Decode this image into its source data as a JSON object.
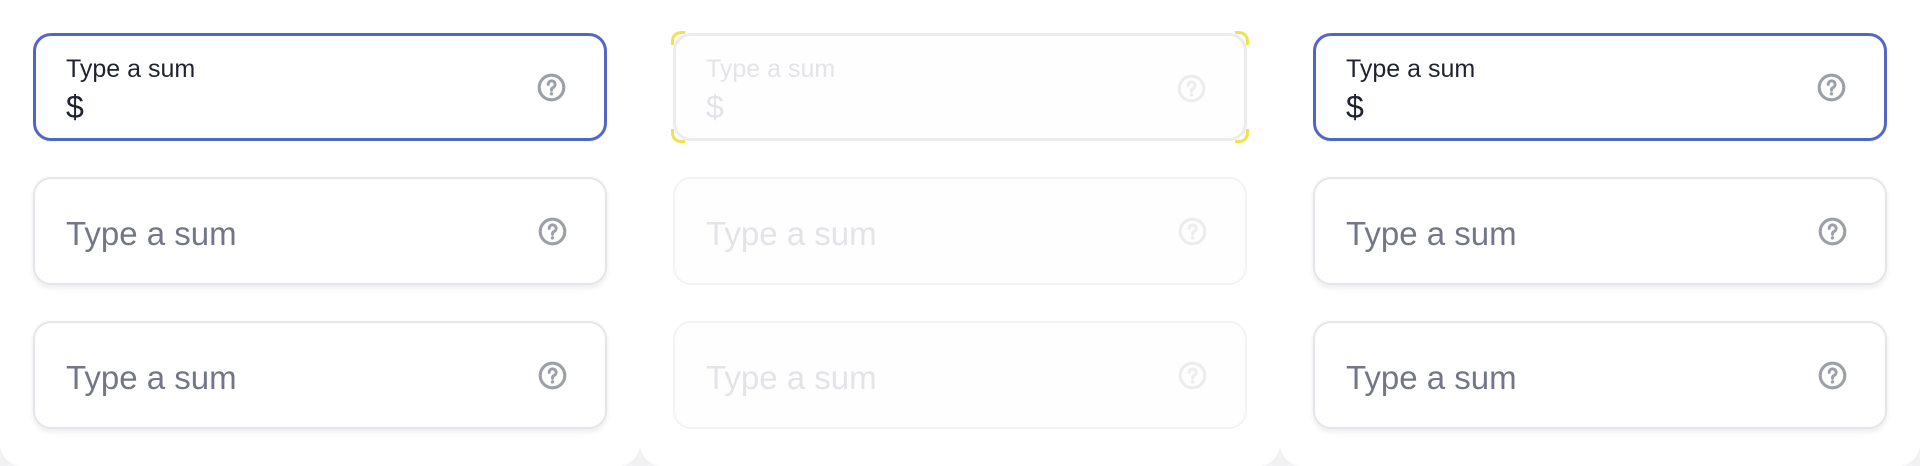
{
  "colors": {
    "accent": "#5266c8",
    "text": "#1f2233",
    "placeholder": "#737689",
    "icon": "#9c9ea8",
    "border": "#e6e6ea",
    "focus_ring_highlight": "#efe24a"
  },
  "columns": [
    {
      "state": "enabled",
      "fields": [
        {
          "label": "Type a sum",
          "value": "$",
          "help_icon": "question-circle-icon"
        },
        {
          "placeholder": "Type a sum",
          "help_icon": "question-circle-icon"
        },
        {
          "placeholder": "Type a sum",
          "help_icon": "question-circle-icon"
        }
      ]
    },
    {
      "state": "disabled",
      "fields": [
        {
          "label": "Type a sum",
          "value": "$",
          "help_icon": "question-circle-icon"
        },
        {
          "placeholder": "Type a sum",
          "help_icon": "question-circle-icon"
        },
        {
          "placeholder": "Type a sum",
          "help_icon": "question-circle-icon"
        }
      ]
    },
    {
      "state": "enabled",
      "fields": [
        {
          "label": "Type a sum",
          "value": "$",
          "help_icon": "question-circle-icon"
        },
        {
          "placeholder": "Type a sum",
          "help_icon": "question-circle-icon"
        },
        {
          "placeholder": "Type a sum",
          "help_icon": "question-circle-icon"
        }
      ]
    }
  ]
}
